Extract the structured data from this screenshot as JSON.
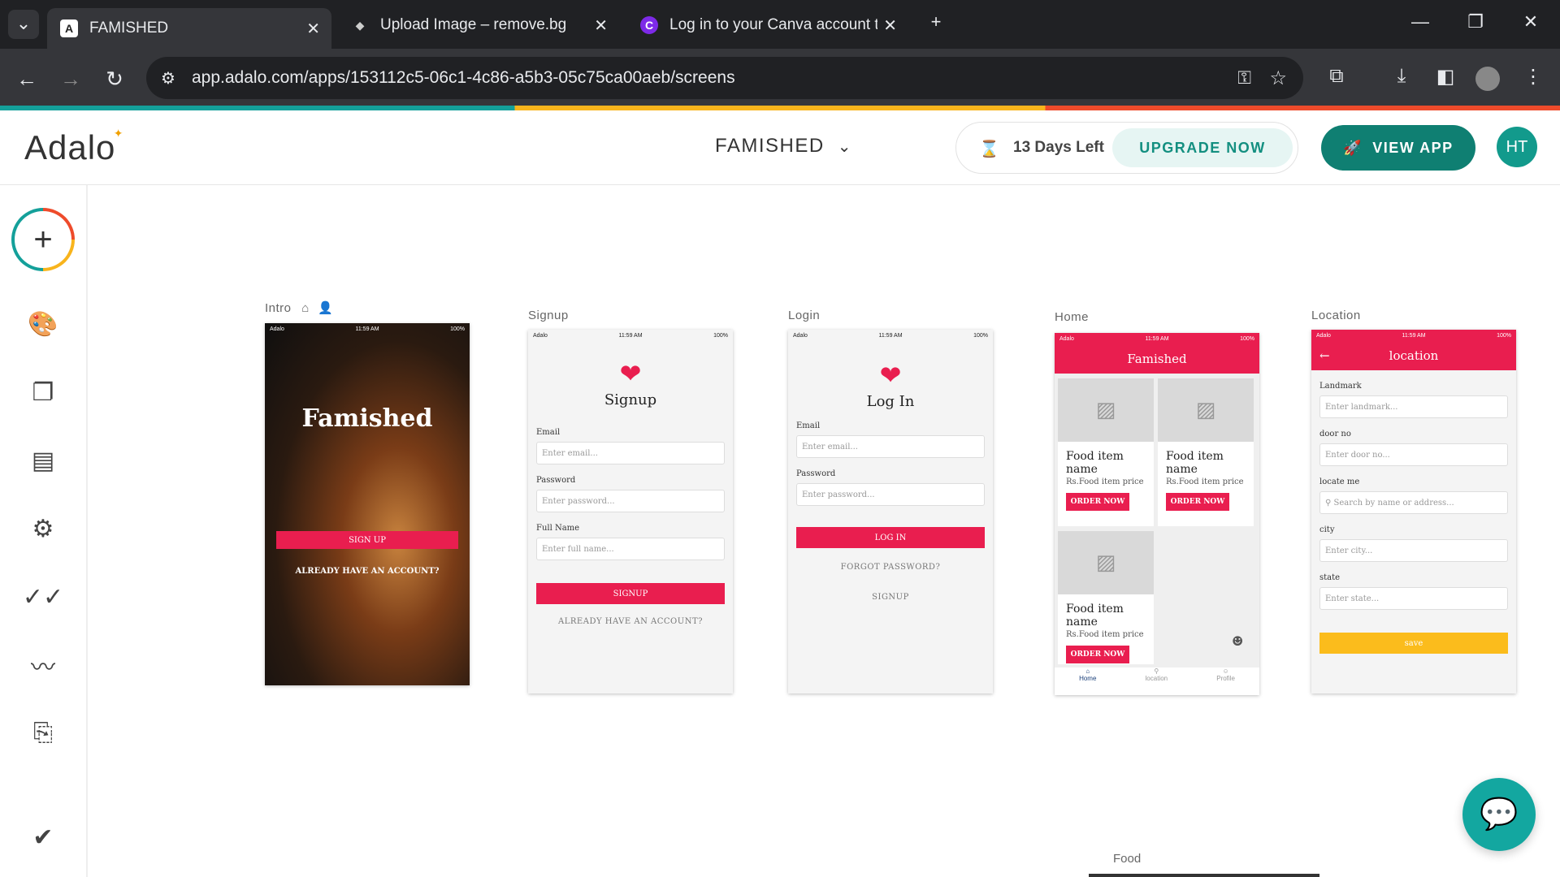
{
  "browser": {
    "tabs": [
      {
        "title": "FAMISHED",
        "favicon": "adalo-icon"
      },
      {
        "title": "Upload Image – remove.bg",
        "favicon": "layers-icon"
      },
      {
        "title": "Log in to your Canva account to",
        "favicon": "canva-icon"
      }
    ],
    "url": "app.adalo.com/apps/153112c5-06c1-4c86-a5b3-05c75ca00aeb/screens"
  },
  "header": {
    "logo": "Adalo",
    "project_name": "FAMISHED",
    "trial_text": "13 Days Left",
    "upgrade_label": "UPGRADE NOW",
    "view_app_label": "VIEW APP",
    "avatar_initials": "HT"
  },
  "screens": {
    "intro": {
      "label": "Intro",
      "title": "Famished",
      "signup_btn": "SIGN UP",
      "have_account": "ALREADY HAVE AN ACCOUNT?",
      "status_left": "Adalo",
      "status_time": "11:59 AM",
      "status_right": "100%"
    },
    "signup": {
      "label": "Signup",
      "title": "Signup",
      "email_label": "Email",
      "email_ph": "Enter email...",
      "password_label": "Password",
      "password_ph": "Enter password...",
      "name_label": "Full Name",
      "name_ph": "Enter full name...",
      "button": "SIGNUP",
      "link": "ALREADY HAVE AN ACCOUNT?",
      "status_left": "Adalo",
      "status_time": "11:59 AM",
      "status_right": "100%"
    },
    "login": {
      "label": "Login",
      "title": "Log In",
      "email_label": "Email",
      "email_ph": "Enter email...",
      "password_label": "Password",
      "password_ph": "Enter password...",
      "button": "LOG IN",
      "forgot": "FORGOT PASSWORD?",
      "signup": "SIGNUP",
      "status_left": "Adalo",
      "status_time": "11:59 AM",
      "status_right": "100%"
    },
    "home": {
      "label": "Home",
      "title": "Famished",
      "cards": [
        {
          "name": "Food item name",
          "price": "Rs.Food item price",
          "button": "ORDER NOW"
        },
        {
          "name": "Food item name",
          "price": "Rs.Food item price",
          "button": "ORDER NOW"
        },
        {
          "name": "Food item name",
          "price": "Rs.Food item price",
          "button": "ORDER NOW"
        }
      ],
      "nav": [
        "Home",
        "location",
        "Profile"
      ],
      "status_left": "Adalo",
      "status_time": "11:59 AM",
      "status_right": "100%"
    },
    "location": {
      "label": "Location",
      "title": "location",
      "landmark_label": "Landmark",
      "landmark_ph": "Enter landmark...",
      "door_label": "door no",
      "door_ph": "Enter door no...",
      "locate_label": "locate me",
      "locate_ph": "Search by name or address...",
      "city_label": "city",
      "city_ph": "Enter city...",
      "state_label": "state",
      "state_ph": "Enter state...",
      "save": "save",
      "status_left": "Adalo",
      "status_time": "11:59 AM",
      "status_right": "100%"
    }
  },
  "bottom_screen_label": "Food"
}
